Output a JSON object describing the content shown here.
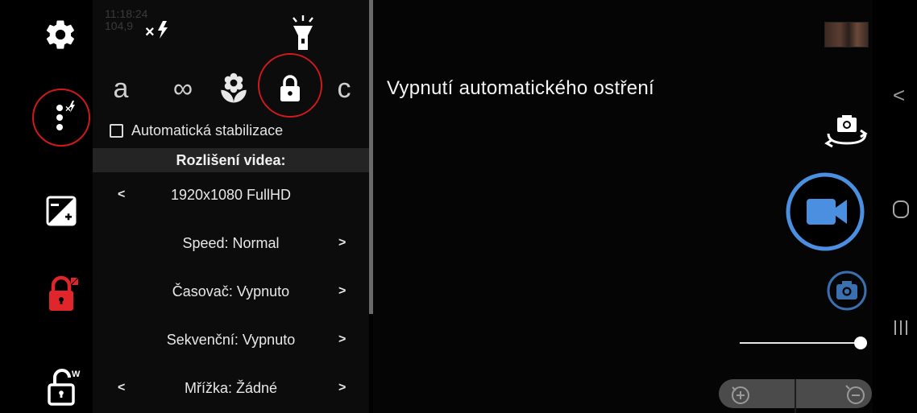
{
  "status": {
    "time": "11:18:24",
    "storage": "104,9"
  },
  "focus_modes": [
    {
      "label": "a",
      "name": "focus-auto"
    },
    {
      "label": "∞",
      "name": "focus-infinity"
    },
    {
      "label": "c",
      "name": "focus-continuous"
    }
  ],
  "settings": {
    "stabilization_label": "Automatická stabilizace",
    "stabilization_checked": false,
    "section_title": "Rozlišení videa:",
    "resolution": "1920x1080 FullHD",
    "speed": "Speed: Normal",
    "timer": "Časovač: Vypnuto",
    "burst": "Sekvenční: Vypnuto",
    "grid": "Mřížka: Žádné",
    "prev_arrow": "<",
    "next_arrow": ">"
  },
  "preview": {
    "tooltip": "Vypnutí automatického ostření"
  },
  "nav": {
    "back": "<",
    "home": "○",
    "recents": "III"
  },
  "slider": {
    "value": 1.0
  },
  "colors": {
    "accent_blue": "#4a8fe0",
    "highlight_red": "#d0191a",
    "lock_red": "#e0262a"
  }
}
